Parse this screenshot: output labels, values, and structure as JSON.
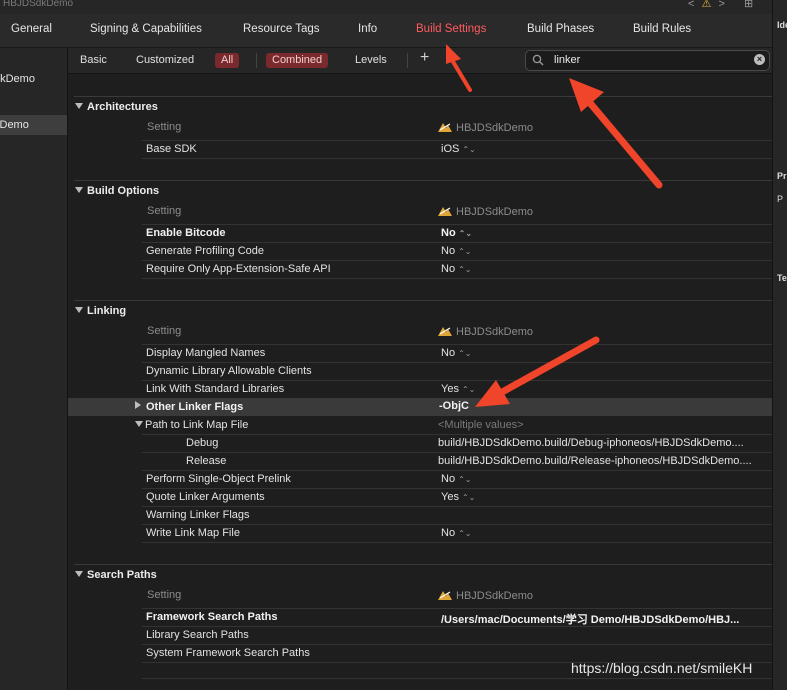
{
  "window": {
    "title": "HBJDSdkDemo",
    "nav_back": "<",
    "nav_warning": "⚠",
    "nav_forward": ">",
    "split_icon": "⊞"
  },
  "tabs": [
    "General",
    "Signing & Capabilities",
    "Resource Tags",
    "Info",
    "Build Settings",
    "Build Phases",
    "Build Rules"
  ],
  "active_tab": "Build Settings",
  "sidebar": {
    "items": [
      "dkDemo",
      "kDemo"
    ]
  },
  "filter": {
    "basic": "Basic",
    "customized": "Customized",
    "all": "All",
    "combined": "Combined",
    "levels": "Levels",
    "add": "+"
  },
  "search": {
    "value": "linker",
    "clear": "×"
  },
  "right_panel": {
    "t1": "Ide",
    "t2": "Pr",
    "t3": "P",
    "t4": "Te"
  },
  "setting_header": "Setting",
  "project": "HBJDSdkDemo",
  "sections": {
    "architectures": {
      "title": "Architectures",
      "rows": [
        {
          "label": "Base SDK",
          "value": "iOS"
        }
      ]
    },
    "build_options": {
      "title": "Build Options",
      "rows": [
        {
          "label": "Enable Bitcode",
          "value": "No"
        },
        {
          "label": "Generate Profiling Code",
          "value": "No"
        },
        {
          "label": "Require Only App-Extension-Safe API",
          "value": "No"
        }
      ]
    },
    "linking": {
      "title": "Linking",
      "rows": [
        {
          "label": "Display Mangled Names",
          "value": "No"
        },
        {
          "label": "Dynamic Library Allowable Clients",
          "value": ""
        },
        {
          "label": "Link With Standard Libraries",
          "value": "Yes"
        },
        {
          "label": "Other Linker Flags",
          "value": "-ObjC"
        },
        {
          "label": "Path to Link Map File",
          "value": "<Multiple values>"
        },
        {
          "label": "Debug",
          "value": "build/HBJDSdkDemo.build/Debug-iphoneos/HBJDSdkDemo...."
        },
        {
          "label": "Release",
          "value": "build/HBJDSdkDemo.build/Release-iphoneos/HBJDSdkDemo...."
        },
        {
          "label": "Perform Single-Object Prelink",
          "value": "No"
        },
        {
          "label": "Quote Linker Arguments",
          "value": "Yes"
        },
        {
          "label": "Warning Linker Flags",
          "value": ""
        },
        {
          "label": "Write Link Map File",
          "value": "No"
        }
      ]
    },
    "search_paths": {
      "title": "Search Paths",
      "rows": [
        {
          "label": "Framework Search Paths",
          "value": "/Users/mac/Documents/学习 Demo/HBJDSdkDemo/HBJ..."
        },
        {
          "label": "Library Search Paths",
          "value": ""
        },
        {
          "label": "System Framework Search Paths",
          "value": ""
        }
      ]
    }
  },
  "stepper": "⌃⌄",
  "watermark": "https://blog.csdn.net/smileKH",
  "colors": {
    "accent": "#ff5a5f",
    "arrow": "#f0442b",
    "selected_filter": "#7a2a2c"
  }
}
